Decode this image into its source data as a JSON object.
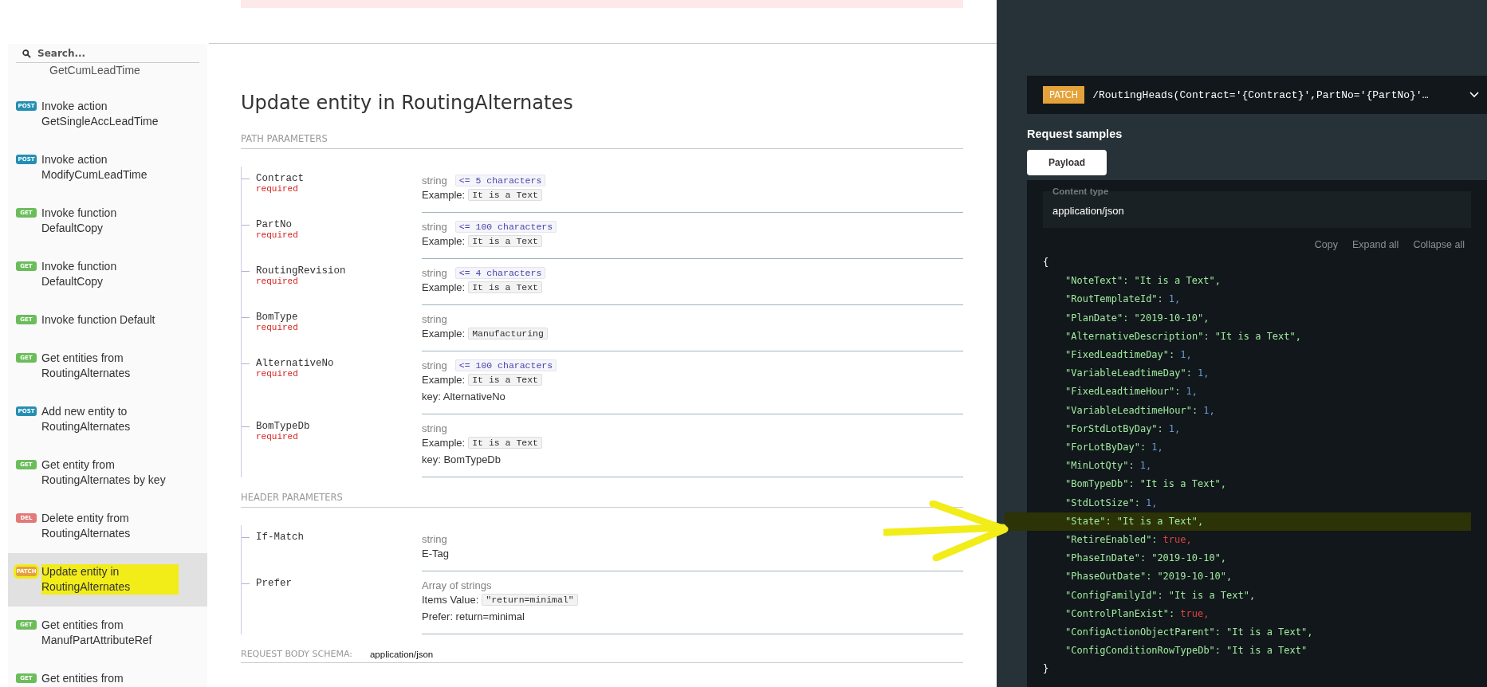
{
  "sidebar": {
    "search": {
      "placeholder": "Search..."
    },
    "items": [
      {
        "label": "GetCumLeadTime",
        "selected": false,
        "highlighted": false
      },
      {
        "method": "POST",
        "label": "Invoke action GetSingleAccLeadTime",
        "color": "#248fb2",
        "selected": false,
        "highlighted": false
      },
      {
        "method": "POST",
        "label": "Invoke action ModifyCumLeadTime",
        "color": "#248fb2",
        "selected": false,
        "highlighted": false
      },
      {
        "method": "GET",
        "label": "Invoke function DefaultCopy",
        "color": "#6bbd5b",
        "selected": false,
        "highlighted": false
      },
      {
        "method": "GET",
        "label": "Invoke function DefaultCopy",
        "color": "#6bbd5b",
        "selected": false,
        "highlighted": false
      },
      {
        "method": "GET",
        "label": "Invoke function Default",
        "color": "#6bbd5b",
        "selected": false,
        "highlighted": false
      },
      {
        "method": "GET",
        "label": "Get entities from RoutingAlternates",
        "color": "#6bbd5b",
        "selected": false,
        "highlighted": false
      },
      {
        "method": "POST",
        "label": "Add new entity to RoutingAlternates",
        "color": "#248fb2",
        "selected": false,
        "highlighted": false
      },
      {
        "method": "GET",
        "label": "Get entity from RoutingAlternates by key",
        "color": "#6bbd5b",
        "selected": false,
        "highlighted": false
      },
      {
        "method": "DEL",
        "label": "Delete entity from RoutingAlternates",
        "color": "#e27a7a",
        "selected": false,
        "highlighted": false
      },
      {
        "method": "PATCH",
        "label": "Update entity in RoutingAlternates",
        "color": "#e5a23a",
        "selected": true,
        "highlighted": true
      },
      {
        "method": "GET",
        "label": "Get entities from ManufPartAttributeRef",
        "color": "#6bbd5b",
        "selected": false,
        "highlighted": false
      },
      {
        "method": "GET",
        "label": "Get entities from",
        "color": "#6bbd5b",
        "selected": false,
        "highlighted": false
      }
    ]
  },
  "operation": {
    "title": "Update entity in RoutingAlternates",
    "sections": [
      {
        "title": "PATH PARAMETERS",
        "rows": [
          {
            "name": "Contract",
            "required": "required",
            "type": "string",
            "constraint": "<= 5 characters",
            "details": [
              {
                "kind": "example",
                "label": "Example:",
                "value": "It is a Text"
              }
            ]
          },
          {
            "name": "PartNo",
            "required": "required",
            "type": "string",
            "constraint": "<= 100 characters",
            "details": [
              {
                "kind": "example",
                "label": "Example:",
                "value": "It is a Text"
              }
            ]
          },
          {
            "name": "RoutingRevision",
            "required": "required",
            "type": "string",
            "constraint": "<= 4 characters",
            "details": [
              {
                "kind": "example",
                "label": "Example:",
                "value": "It is a Text"
              }
            ]
          },
          {
            "name": "BomType",
            "required": "required",
            "type": "string",
            "details": [
              {
                "kind": "example",
                "label": "Example:",
                "value": "Manufacturing"
              }
            ]
          },
          {
            "name": "AlternativeNo",
            "required": "required",
            "type": "string",
            "constraint": "<= 100 characters",
            "details": [
              {
                "kind": "example",
                "label": "Example:",
                "value": "It is a Text"
              },
              {
                "kind": "text",
                "value": "key: AlternativeNo"
              }
            ]
          },
          {
            "name": "BomTypeDb",
            "required": "required",
            "type": "string",
            "details": [
              {
                "kind": "example",
                "label": "Example:",
                "value": "It is a Text"
              },
              {
                "kind": "text",
                "value": "key: BomTypeDb"
              }
            ]
          }
        ]
      },
      {
        "title": "HEADER PARAMETERS",
        "rows": [
          {
            "name": "If-Match",
            "type": "string",
            "details": [
              {
                "kind": "text",
                "value": "E-Tag"
              }
            ]
          },
          {
            "name": "Prefer",
            "type": "Array of strings",
            "details": [
              {
                "kind": "example",
                "label": "Items Value:",
                "value": "\"return=minimal\""
              },
              {
                "kind": "text",
                "value": "Prefer: return=minimal"
              }
            ]
          }
        ]
      }
    ],
    "body_schema": {
      "label": "REQUEST BODY SCHEMA:",
      "value": "application/json"
    }
  },
  "samples": {
    "method": "PATCH",
    "path": "/RoutingHeads(Contract='{Contract}',PartNo='{PartNo}'…",
    "title": "Request samples",
    "tabs": [
      {
        "label": "Payload",
        "selected": true
      }
    ],
    "content_type": {
      "label": "Content type",
      "value": "application/json"
    },
    "actions": [
      "Copy",
      "Expand all",
      "Collapse all"
    ],
    "code": {
      "open": "{",
      "close": "}",
      "lines": [
        {
          "key": "\"NoteText\":",
          "value": "\"It is a Text\",",
          "kind": "string",
          "highlighted": false
        },
        {
          "key": "\"RoutTemplateId\":",
          "value": "1,",
          "kind": "number",
          "highlighted": false
        },
        {
          "key": "\"PlanDate\":",
          "value": "\"2019-10-10\",",
          "kind": "string",
          "highlighted": false
        },
        {
          "key": "\"AlternativeDescription\":",
          "value": "\"It is a Text\",",
          "kind": "string",
          "highlighted": false
        },
        {
          "key": "\"FixedLeadtimeDay\":",
          "value": "1,",
          "kind": "number",
          "highlighted": false
        },
        {
          "key": "\"VariableLeadtimeDay\":",
          "value": "1,",
          "kind": "number",
          "highlighted": false
        },
        {
          "key": "\"FixedLeadtimeHour\":",
          "value": "1,",
          "kind": "number",
          "highlighted": false
        },
        {
          "key": "\"VariableLeadtimeHour\":",
          "value": "1,",
          "kind": "number",
          "highlighted": false
        },
        {
          "key": "\"ForStdLotByDay\":",
          "value": "1,",
          "kind": "number",
          "highlighted": false
        },
        {
          "key": "\"ForLotByDay\":",
          "value": "1,",
          "kind": "number",
          "highlighted": false
        },
        {
          "key": "\"MinLotQty\":",
          "value": "1,",
          "kind": "number",
          "highlighted": false
        },
        {
          "key": "\"BomTypeDb\":",
          "value": "\"It is a Text\",",
          "kind": "string",
          "highlighted": false
        },
        {
          "key": "\"StdLotSize\":",
          "value": "1,",
          "kind": "number",
          "highlighted": false
        },
        {
          "key": "\"State\":",
          "value": "\"It is a Text\",",
          "kind": "string",
          "highlighted": true
        },
        {
          "key": "\"RetireEnabled\":",
          "value": "true,",
          "kind": "boolean",
          "highlighted": false
        },
        {
          "key": "\"PhaseInDate\":",
          "value": "\"2019-10-10\",",
          "kind": "string",
          "highlighted": false
        },
        {
          "key": "\"PhaseOutDate\":",
          "value": "\"2019-10-10\",",
          "kind": "string",
          "highlighted": false
        },
        {
          "key": "\"ConfigFamilyId\":",
          "value": "\"It is a Text\",",
          "kind": "string",
          "highlighted": false
        },
        {
          "key": "\"ControlPlanExist\":",
          "value": "true,",
          "kind": "boolean",
          "highlighted": false
        },
        {
          "key": "\"ConfigActionObjectParent\":",
          "value": "\"It is a Text\",",
          "kind": "string",
          "highlighted": false
        },
        {
          "key": "\"ConfigConditionRowTypeDb\":",
          "value": "\"It is a Text\"",
          "kind": "string",
          "highlighted": false
        }
      ]
    }
  }
}
